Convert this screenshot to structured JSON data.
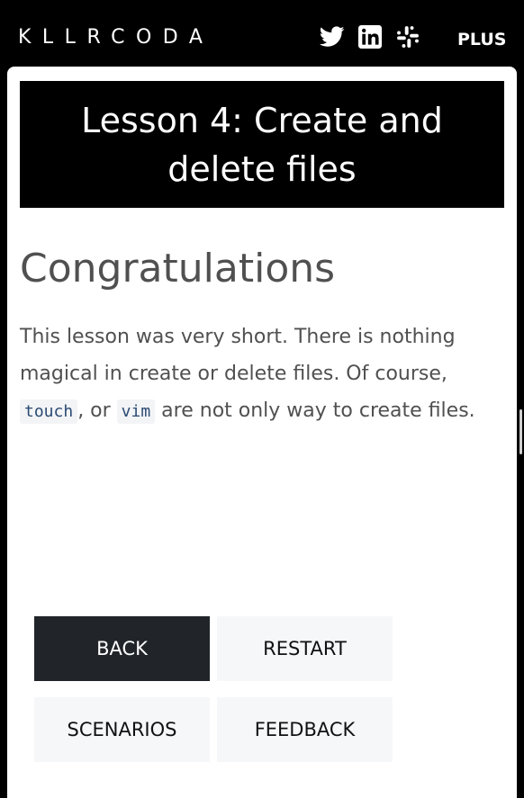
{
  "header": {
    "logo_text": "KLLRCODA",
    "social_icons": [
      "twitter-icon",
      "linkedin-icon",
      "slack-icon"
    ],
    "plus_label": "PLUS"
  },
  "lesson": {
    "title": "Lesson 4: Create and delete files"
  },
  "content": {
    "heading": "Congratulations",
    "text_part1": "This lesson was very short. There is nothing magical in create or delete files. Of course, ",
    "code1": "touch",
    "text_part2": ", or ",
    "code2": "vim",
    "text_part3": " are not only way to create files."
  },
  "buttons": {
    "back": "BACK",
    "restart": "RESTART",
    "scenarios": "SCENARIOS",
    "feedback": "FEEDBACK"
  },
  "colors": {
    "header_bg": "#000000",
    "primary_button": "#212529",
    "secondary_button": "#f6f7f9",
    "text": "#505050",
    "code_text": "#2a4a73"
  }
}
